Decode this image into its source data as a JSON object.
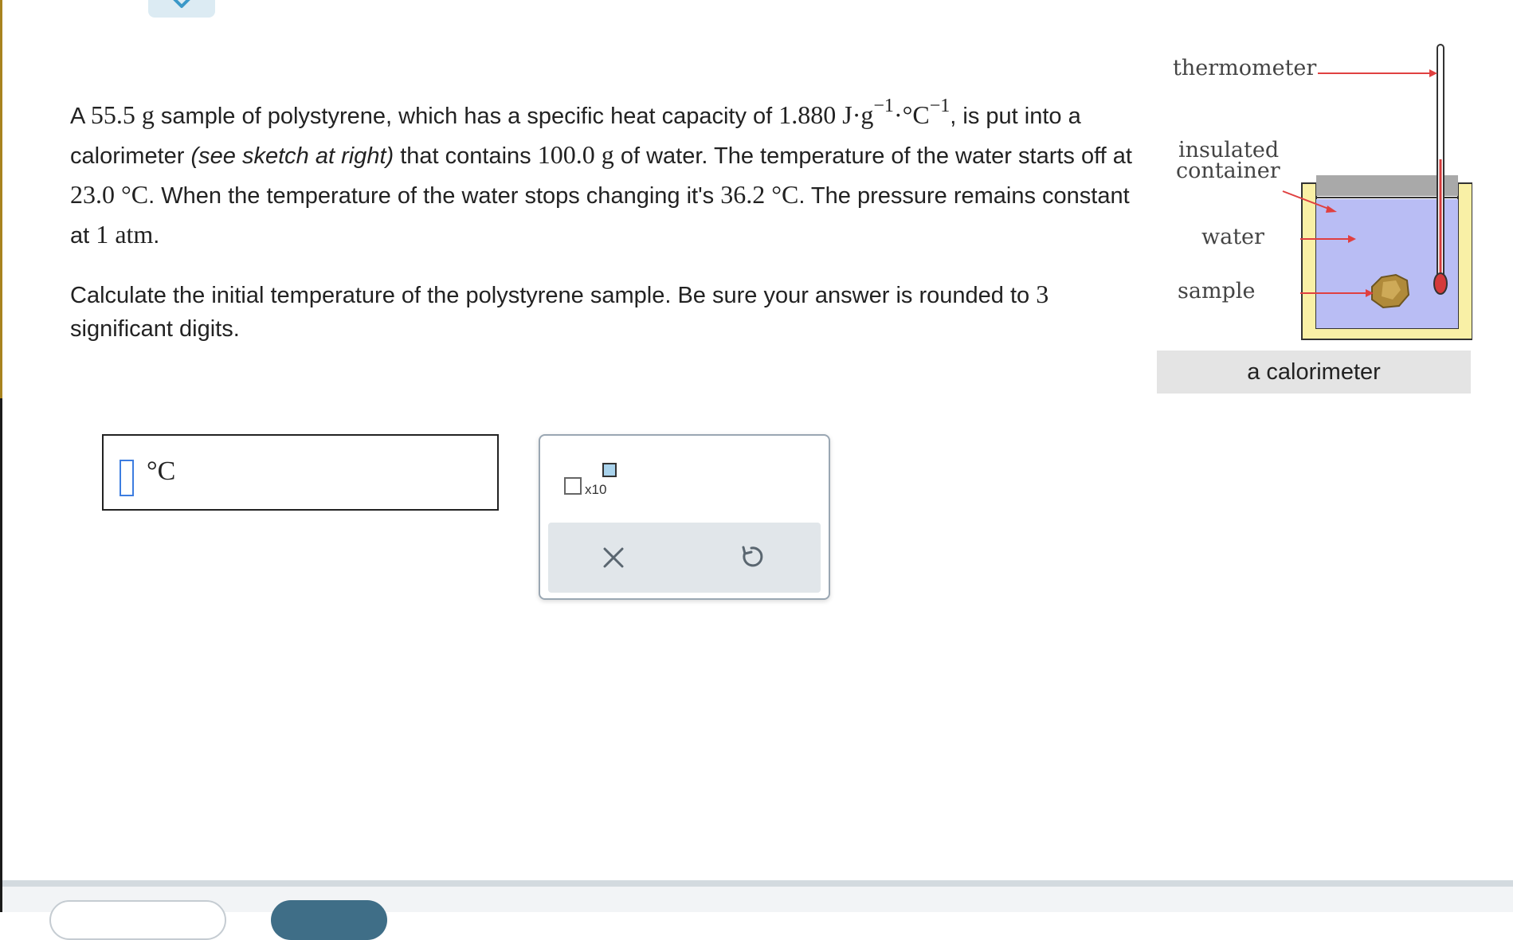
{
  "problem": {
    "p1": {
      "t1": "A ",
      "mass": "55.5",
      "t2": " ",
      "mass_unit": "g",
      "t3": " sample of polystyrene, which has a specific heat capacity of ",
      "cap_value": "1.880",
      "cap_unit_a": " J·g",
      "exp1": "−1",
      "cap_unit_b": "·°C",
      "exp2": "−1",
      "t4": ", is put into a calorimeter ",
      "italic": "(see sketch at right)",
      "t5": " that contains ",
      "water_mass": "100.0",
      "t6": " ",
      "water_unit": "g",
      "t7": " of water. The temperature of the water starts off at ",
      "t_start": "23.0 °C",
      "t8": ". When the temperature of the water stops changing it's ",
      "t_end": "36.2 °C",
      "t9": ". The pressure remains constant at ",
      "pressure": "1",
      "t10": " ",
      "pressure_unit": "atm",
      "t11": "."
    },
    "p2": {
      "t1": "Calculate the initial temperature of the polystyrene sample. Be sure your answer is rounded to ",
      "digits": "3",
      "t2": " significant digits."
    }
  },
  "figure": {
    "labels": {
      "thermometer": "thermometer",
      "insulated": "insulated",
      "container": "container",
      "water": "water",
      "sample": "sample"
    },
    "caption": "a calorimeter",
    "colors": {
      "water": "#b9bdf4",
      "container": "#f9f0a6",
      "lid": "#a9a9a9",
      "arrow": "#e04040",
      "thermometer_bulb": "#d43a3a",
      "sample": "#b08a3a"
    }
  },
  "answer": {
    "unit": "°C",
    "value": ""
  },
  "keypad": {
    "sci_label": "x10",
    "clear_icon": "close-icon",
    "undo_icon": "undo-icon"
  },
  "colors": {
    "accent": "#3d7de0",
    "keypad_bar": "#e1e6ea",
    "footer_button": "#3f6e87"
  }
}
